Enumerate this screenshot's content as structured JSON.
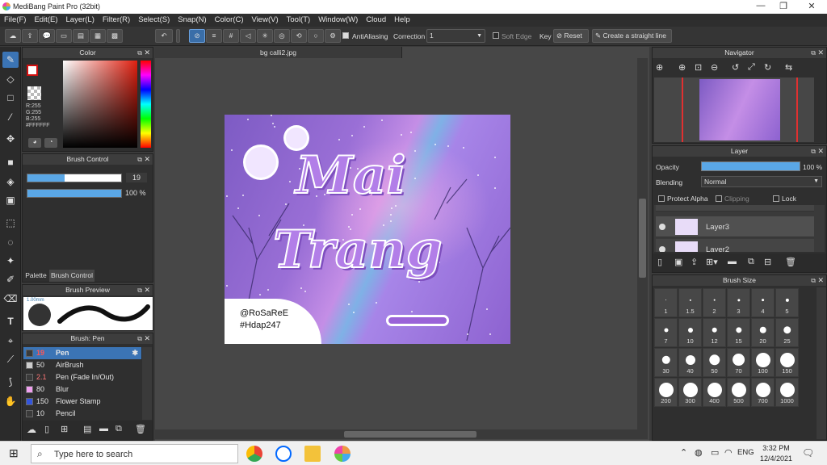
{
  "window": {
    "title": "MediBang Paint Pro (32bit)"
  },
  "menu": [
    "File(F)",
    "Edit(E)",
    "Layer(L)",
    "Filter(R)",
    "Select(S)",
    "Snap(N)",
    "Color(C)",
    "View(V)",
    "Tool(T)",
    "Window(W)",
    "Cloud",
    "Help"
  ],
  "toolbar": {
    "antialiasing_label": "AntiAliasing",
    "correction_label": "Correction",
    "correction_value": "1",
    "soft_edge_label": "Soft Edge",
    "key_label": "Key",
    "reset_label": "Reset",
    "straight_line_label": "Create a straight line"
  },
  "color_panel": {
    "title": "Color",
    "r": "R:255",
    "g": "G:255",
    "b": "B:255",
    "hex": "#FFFFFF",
    "fg_color": "#ffffff",
    "accent_red": "#d01010"
  },
  "brush_control": {
    "title": "Brush Control",
    "size_value": "19",
    "opacity_value": "100 %",
    "tab_palette": "Palette",
    "tab_brush_control": "Brush Control",
    "size_fill": 0.4,
    "opacity_fill": 1.0
  },
  "brush_preview": {
    "title": "Brush Preview",
    "tip_label": "1.00mm"
  },
  "brush_list": {
    "title": "Brush: Pen",
    "items": [
      {
        "size": "19",
        "name": "Pen",
        "color": "#3a3a3a",
        "selected": true
      },
      {
        "size": "50",
        "name": "AirBrush",
        "color": "#cccccc"
      },
      {
        "size": "2.1",
        "name": "Pen (Fade In/Out)",
        "color": "#3a3a3a"
      },
      {
        "size": "80",
        "name": "Blur",
        "color": "#f0a0f0"
      },
      {
        "size": "150",
        "name": "Flower Stamp",
        "color": "#3355dd"
      },
      {
        "size": "10",
        "name": "Pencil",
        "color": "#3a3a3a"
      }
    ]
  },
  "document": {
    "tab_name": "bg calli2.jpg",
    "art_line1": "Mai",
    "art_line2": "Trang",
    "watermark_line1": "@RoSaReE",
    "watermark_line2": "#Hdap247"
  },
  "navigator": {
    "title": "Navigator"
  },
  "layer_panel": {
    "title": "Layer",
    "opacity_label": "Opacity",
    "opacity_value": "100 %",
    "blending_label": "Blending",
    "blending_value": "Normal",
    "protect_alpha_label": "Protect Alpha",
    "clipping_label": "Clipping",
    "lock_label": "Lock",
    "layers": [
      {
        "name": "Layer3"
      },
      {
        "name": "Layer2"
      }
    ]
  },
  "brush_size_panel": {
    "title": "Brush Size",
    "sizes": [
      "1",
      "1.5",
      "2",
      "3",
      "4",
      "5",
      "7",
      "10",
      "12",
      "15",
      "20",
      "25",
      "30",
      "40",
      "50",
      "70",
      "100",
      "150",
      "200",
      "300",
      "400",
      "500",
      "700",
      "1000"
    ]
  },
  "taskbar": {
    "search_placeholder": "Type here to search",
    "language": "ENG",
    "time": "3:32 PM",
    "date": "12/4/2021"
  }
}
